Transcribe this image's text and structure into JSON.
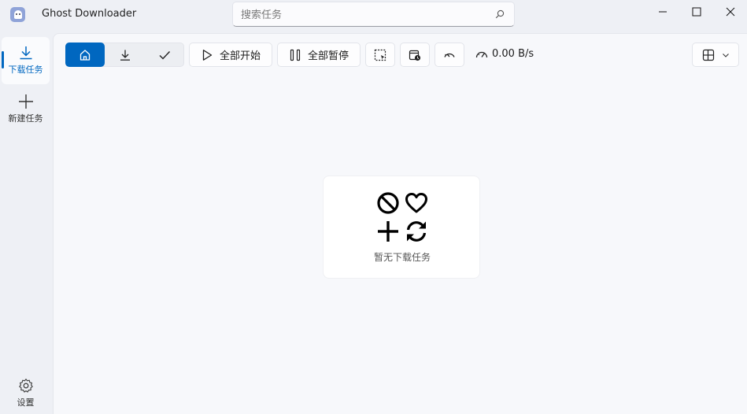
{
  "app": {
    "title": "Ghost Downloader",
    "icon": "ghost-app-icon"
  },
  "search": {
    "placeholder": "搜索任务",
    "value": ""
  },
  "window_controls": [
    "minimize-icon",
    "maximize-icon",
    "close-icon"
  ],
  "sidebar": {
    "items": [
      {
        "label": "下载任务",
        "icon": "download-icon",
        "active": true
      },
      {
        "label": "新建任务",
        "icon": "plus-icon",
        "active": false
      }
    ],
    "footer": {
      "label": "设置",
      "icon": "gear-icon"
    }
  },
  "toolbar": {
    "filters": [
      {
        "icon": "home-icon",
        "selected": true
      },
      {
        "icon": "download-icon",
        "selected": false
      },
      {
        "icon": "check-icon",
        "selected": false
      }
    ],
    "start_all_label": "全部开始",
    "pause_all_label": "全部暂停",
    "speed": "0.00 B/s",
    "accent_color": "#0067c0"
  },
  "empty_state": {
    "text": "暂无下载任务",
    "icons": [
      "prohibited-icon",
      "heart-icon",
      "plus-icon",
      "refresh-icon"
    ]
  }
}
